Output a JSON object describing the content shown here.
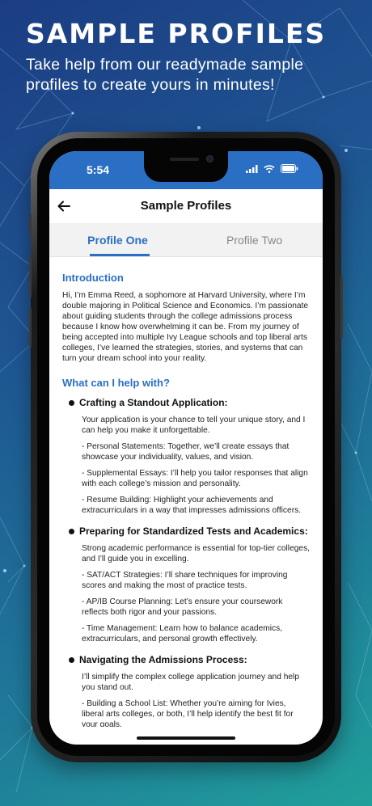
{
  "promo": {
    "headline": "SAMPLE PROFILES",
    "subheadline": "Take help from our readymade sample profiles to create yours in minutes!"
  },
  "status_bar": {
    "time": "5:54"
  },
  "nav": {
    "title": "Sample Profiles",
    "back_icon": "arrow-left-icon"
  },
  "tabs": [
    {
      "label": "Profile One",
      "active": true
    },
    {
      "label": "Profile Two",
      "active": false
    }
  ],
  "profile": {
    "intro_title": "Introduction",
    "intro_text": "Hi, I’m Emma Reed, a sophomore at Harvard University, where I’m double majoring in Political Science and Economics. I’m passionate about guiding students through the college admissions process because I know how overwhelming it can be. From my journey of being accepted into multiple Ivy League schools and top liberal arts colleges, I’ve learned the strategies, stories, and systems that can turn your dream school into your reality.",
    "help_title": "What can I help with?",
    "sections": [
      {
        "heading": "Crafting a Standout Application:",
        "paragraphs": [
          "Your application is your chance to tell your unique story, and I can help you make it unforgettable.",
          "- Personal Statements: Together, we’ll create essays that showcase your individuality, values, and vision.",
          "- Supplemental Essays: I’ll help you tailor responses that align with each college’s mission and personality.",
          "- Resume Building: Highlight your achievements and extracurriculars in a way that impresses admissions officers."
        ]
      },
      {
        "heading": "Preparing for Standardized Tests and Academics:",
        "paragraphs": [
          "Strong academic performance is essential for top-tier colleges, and I’ll guide you in excelling.",
          "- SAT/ACT Strategies: I’ll share techniques for improving scores and making the most of practice tests.",
          "- AP/IB Course Planning: Let’s ensure your coursework reflects both rigor and your passions.",
          "- Time Management: Learn how to balance academics, extracurriculars, and personal growth effectively."
        ]
      },
      {
        "heading": "Navigating the Admissions Process:",
        "paragraphs": [
          "I’ll simplify the complex college application journey and help you stand out.",
          "- Building a School List: Whether you’re aiming for Ivies, liberal arts colleges, or both, I’ll help identify the best fit for your goals."
        ]
      }
    ]
  },
  "colors": {
    "accent": "#2a6fc4",
    "tab_inactive": "#888888"
  }
}
